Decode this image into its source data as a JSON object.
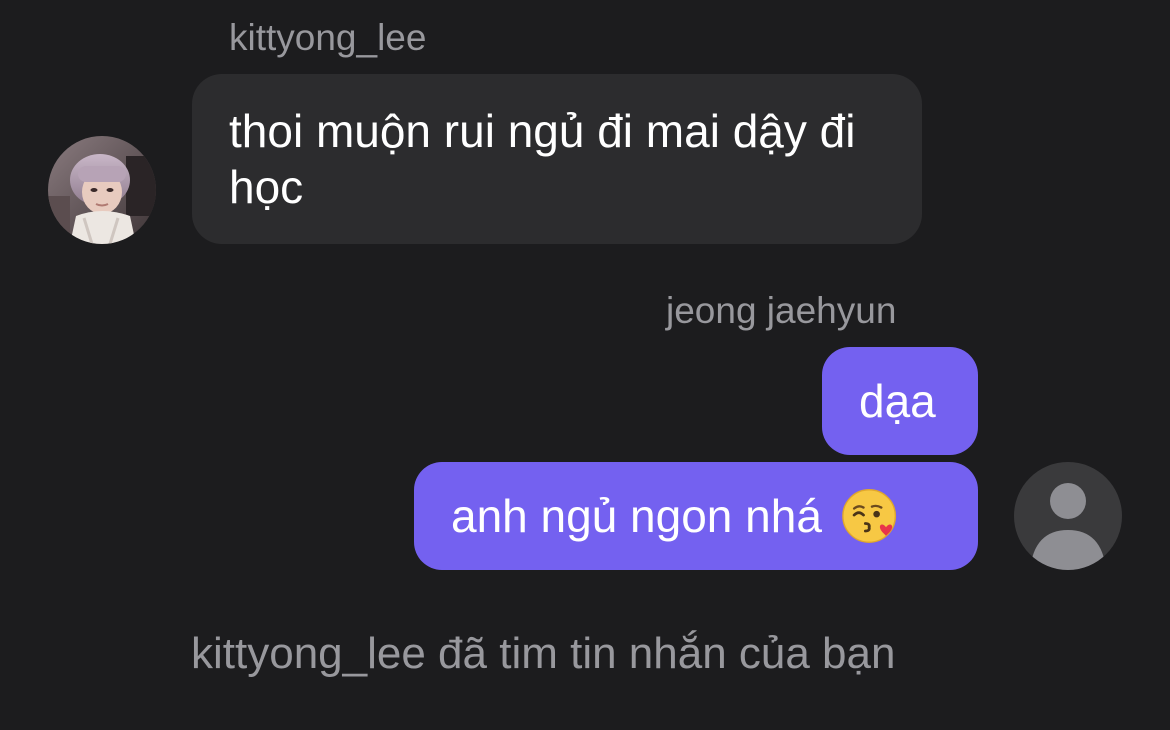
{
  "thread": {
    "incoming_sender": "kittyong_lee",
    "incoming_message": "thoi muộn rui ngủ đi mai dậy đi học",
    "outgoing_sender": "jeong jaehyun",
    "outgoing_messages": [
      {
        "text": "dạa"
      },
      {
        "text": "anh ngủ ngon nhá",
        "emoji": "face-blowing-kiss"
      }
    ],
    "reaction_notice": "kittyong_lee đã tim tin nhắn của bạn"
  },
  "colors": {
    "background": "#1c1c1e",
    "incoming_bubble": "#2c2c2e",
    "outgoing_bubble": "#7461f0",
    "secondary_text": "#98989d"
  },
  "icons": {
    "incoming_avatar": "user-photo-avatar",
    "outgoing_avatar": "default-person-avatar-icon"
  }
}
